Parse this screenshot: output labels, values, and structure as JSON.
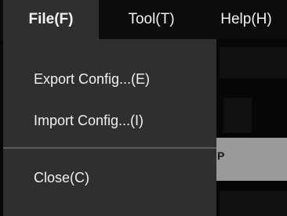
{
  "menubar": {
    "items": [
      {
        "label": "File(F)",
        "active": true
      },
      {
        "label": "Tool(T)",
        "active": false
      },
      {
        "label": "Help(H)",
        "active": false
      }
    ]
  },
  "file_menu": {
    "items": [
      {
        "label": "Export Config...(E)"
      },
      {
        "label": "Import Config...(I)"
      },
      {
        "label": "Close(C)"
      }
    ]
  },
  "background": {
    "highlight_text": "P"
  },
  "colors": {
    "menubar_bg": "#0c0c0c",
    "menu_bg": "#2f2f2f",
    "text": "#f0f0f0",
    "separator": "#5b5b5b",
    "background_highlight": "#9a9a9a"
  }
}
